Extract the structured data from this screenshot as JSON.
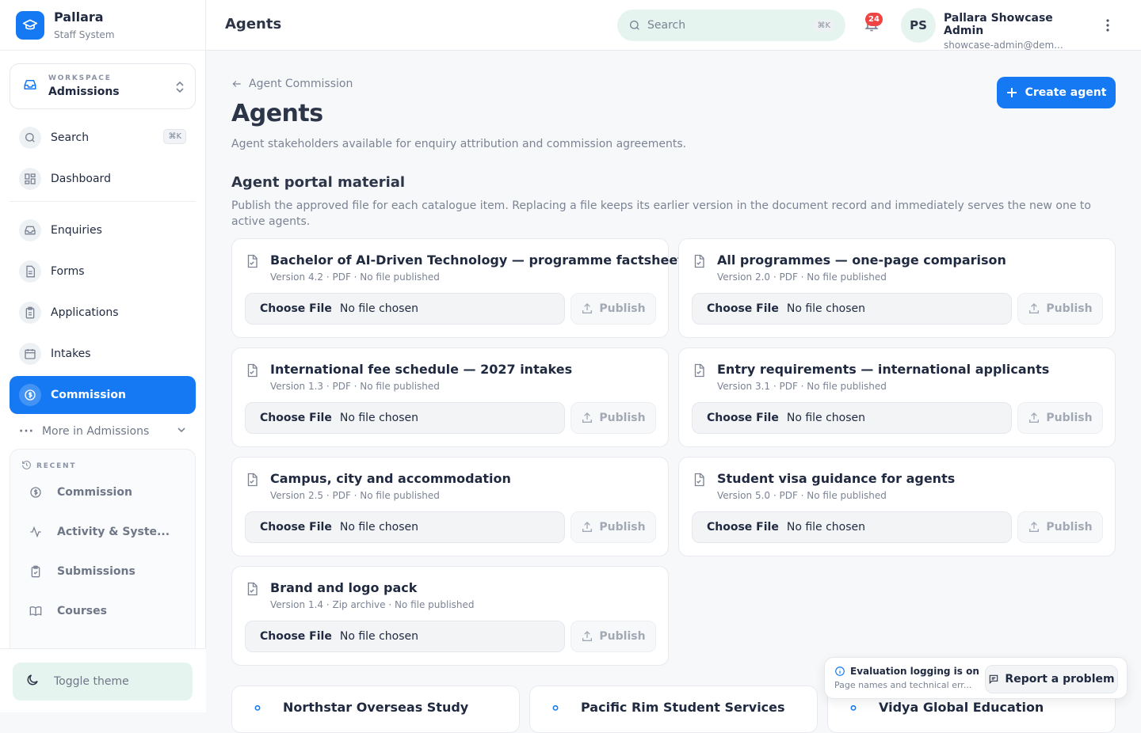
{
  "brand": {
    "name": "Pallara",
    "subtitle": "Staff System"
  },
  "workspace": {
    "label": "WORKSPACE",
    "name": "Admissions"
  },
  "sidebar": {
    "search": {
      "label": "Search",
      "shortcut": "⌘K"
    },
    "items": [
      {
        "label": "Dashboard",
        "icon": "dashboard-icon"
      },
      {
        "label": "Enquiries",
        "icon": "inbox-icon"
      },
      {
        "label": "Forms",
        "icon": "document-icon"
      },
      {
        "label": "Applications",
        "icon": "clipboard-icon"
      },
      {
        "label": "Intakes",
        "icon": "calendar-icon"
      },
      {
        "label": "Commission",
        "icon": "dollar-icon",
        "active": true
      }
    ],
    "more": "More in Admissions",
    "recent_title": "RECENT",
    "recent": [
      {
        "label": "Commission",
        "icon": "dollar-icon"
      },
      {
        "label": "Activity & Syste...",
        "icon": "activity-icon"
      },
      {
        "label": "Submissions",
        "icon": "clipboard-icon"
      },
      {
        "label": "Courses",
        "icon": "book-icon"
      }
    ],
    "toggle_theme": "Toggle theme"
  },
  "topbar": {
    "title": "Agents",
    "search_placeholder": "Search",
    "search_shortcut": "⌘K",
    "notifications": "24",
    "avatar_initials": "PS",
    "user_name": "Pallara Showcase Admin",
    "user_email": "showcase-admin@dem..."
  },
  "page": {
    "back": "Agent Commission",
    "title": "Agents",
    "subtitle": "Agent stakeholders available for enquiry attribution and commission agreements.",
    "create_button": "Create agent",
    "section_title": "Agent portal material",
    "section_desc": "Publish the approved file for each catalogue item. Replacing a file keeps its earlier version in the document record and immediately serves the new one to active agents."
  },
  "file_input": {
    "button": "Choose File",
    "status": "No file chosen"
  },
  "publish_label": "Publish",
  "materials": [
    {
      "title": "Bachelor of AI-Driven Technology — programme factsheet",
      "meta": "Version 4.2 · PDF · No file published"
    },
    {
      "title": "All programmes — one-page comparison",
      "meta": "Version 2.0 · PDF · No file published"
    },
    {
      "title": "International fee schedule — 2027 intakes",
      "meta": "Version 1.3 · PDF · No file published"
    },
    {
      "title": "Entry requirements — international applicants",
      "meta": "Version 3.1 · PDF · No file published"
    },
    {
      "title": "Campus, city and accommodation",
      "meta": "Version 2.5 · PDF · No file published"
    },
    {
      "title": "Student visa guidance for agents",
      "meta": "Version 5.0 · PDF · No file published"
    },
    {
      "title": "Brand and logo pack",
      "meta": "Version 1.4 · Zip archive · No file published"
    }
  ],
  "agents": [
    {
      "name": "Northstar Overseas Study"
    },
    {
      "name": "Pacific Rim Student Services"
    },
    {
      "name": "Vidya Global Education"
    }
  ],
  "toast": {
    "title": "Evaluation logging is on",
    "subtitle": "Page names and technical err...",
    "report": "Report a problem"
  },
  "colors": {
    "accent": "#1479f2",
    "mint": "#e6f4ef",
    "badge": "#ef4444"
  }
}
